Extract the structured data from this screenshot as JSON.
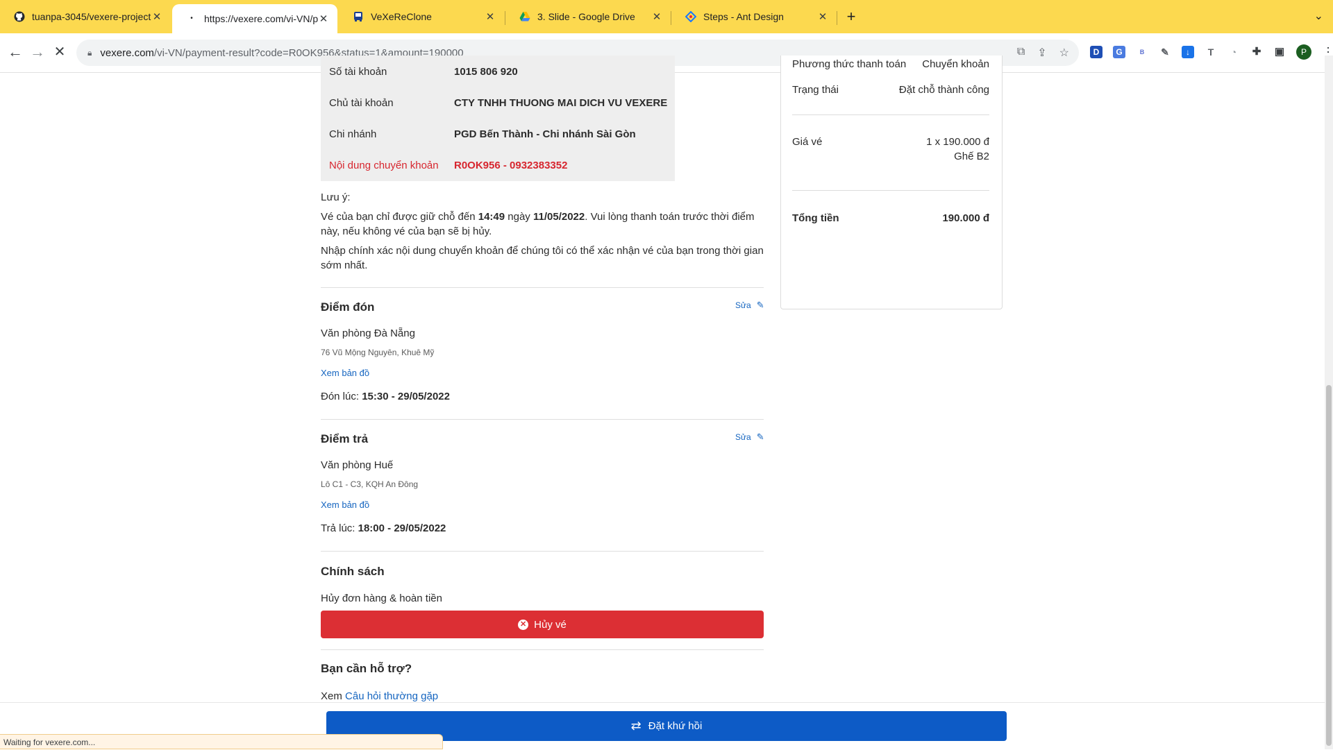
{
  "browser": {
    "tabs": [
      {
        "title": "tuanpa-3045/vexere-project",
        "icon": "github-icon"
      },
      {
        "title": "https://vexere.com/vi-VN/paym",
        "icon": "loading-dot-icon"
      },
      {
        "title": "VeXeReClone",
        "icon": "bus-icon"
      },
      {
        "title": "3. Slide - Google Drive",
        "icon": "google-drive-icon"
      },
      {
        "title": "Steps - Ant Design",
        "icon": "ant-design-icon"
      }
    ],
    "url_host": "vexere.com",
    "url_path": "/vi-VN/payment-result?code=R0OK956&status=1&amount=190000",
    "status_text": "Waiting for vexere.com...",
    "profile_initial": "P"
  },
  "bank": {
    "rows": [
      {
        "label": "Số tài khoản",
        "value": "1015 806 920"
      },
      {
        "label": "Chủ tài khoản",
        "value": "CTY TNHH THUONG MAI DICH VU VEXERE"
      },
      {
        "label": "Chi nhánh",
        "value": "PGD Bến Thành - Chi nhánh Sài Gòn"
      },
      {
        "label": "Nội dung chuyển khoản",
        "value": "R0OK956 - 0932383352"
      }
    ]
  },
  "note": {
    "title": "Lưu ý:",
    "line1_a": "Vé của bạn chỉ được giữ chỗ đến ",
    "line1_time": "14:49",
    "line1_b": " ngày ",
    "line1_date": "11/05/2022",
    "line1_c": ". Vui lòng thanh toán trước thời điểm này, nếu không vé của bạn sẽ bị hủy.",
    "line2": "Nhập chính xác nội dung chuyển khoản để chúng tôi có thể xác nhận vé của bạn trong thời gian sớm nhất."
  },
  "pickup": {
    "title": "Điểm đón",
    "edit": "Sửa",
    "place": "Văn phòng Đà Nẵng",
    "address": "76 Vũ Mộng Nguyên, Khuê Mỹ",
    "map": "Xem bản đồ",
    "time_label": "Đón lúc: ",
    "time": "15:30 - 29/05/2022"
  },
  "dropoff": {
    "title": "Điểm trả",
    "edit": "Sửa",
    "place": "Văn phòng Huế",
    "address": "Lô C1 - C3, KQH An Đông",
    "map": "Xem bản đồ",
    "time_label": "Trả lúc: ",
    "time": "18:00 - 29/05/2022"
  },
  "policy": {
    "title": "Chính sách",
    "subtitle": "Hủy đơn hàng & hoàn tiền",
    "cancel_button": "Hủy vé"
  },
  "support": {
    "title": "Bạn cần hỗ trợ?",
    "prefix": "Xem ",
    "link": "Câu hỏi thường gặp"
  },
  "summary": {
    "payment_method_label": "Phương thức thanh toán",
    "payment_method": "Chuyển khoản",
    "status_label": "Trạng thái",
    "status": "Đặt chỗ thành công",
    "price_label": "Giá vé",
    "price": "1 x 190.000 đ",
    "seat": "Ghế B2",
    "total_label": "Tổng tiền",
    "total": "190.000 đ"
  },
  "return_button": "Đặt khứ hồi",
  "colors": {
    "chrome_yellow": "#fcd94f",
    "danger": "#dc2f34",
    "primary": "#0d5bc6",
    "link": "#1565c0"
  }
}
